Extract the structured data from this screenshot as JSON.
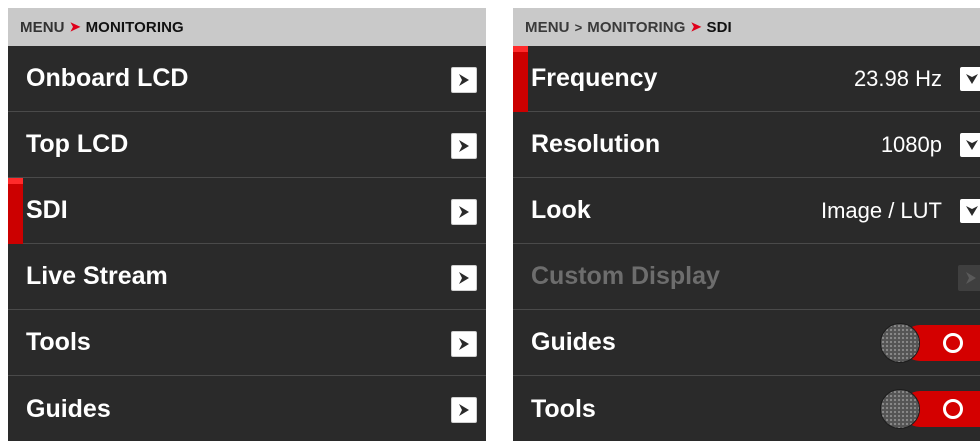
{
  "left": {
    "breadcrumb": {
      "root": "MENU",
      "sep": "➤",
      "current": "MONITORING"
    },
    "items": [
      {
        "label": "Onboard LCD",
        "selected": false
      },
      {
        "label": "Top LCD",
        "selected": false
      },
      {
        "label": "SDI",
        "selected": true
      },
      {
        "label": "Live Stream",
        "selected": false
      },
      {
        "label": "Tools",
        "selected": false
      },
      {
        "label": "Guides",
        "selected": false
      }
    ]
  },
  "right": {
    "breadcrumb": {
      "root": "MENU",
      "sep1": ">",
      "middle": "MONITORING",
      "sep2": "➤",
      "current": "SDI"
    },
    "frequency": {
      "label": "Frequency",
      "value": "23.98 Hz"
    },
    "resolution": {
      "label": "Resolution",
      "value": "1080p"
    },
    "look": {
      "label": "Look",
      "value": "Image / LUT"
    },
    "custom_display": {
      "label": "Custom Display",
      "enabled": false
    },
    "guides": {
      "label": "Guides",
      "toggle": "on"
    },
    "tools": {
      "label": "Tools",
      "toggle": "on"
    }
  },
  "colors": {
    "accent": "#cc0000",
    "panel": "#2a2a2a",
    "header": "#c9c9c9",
    "toggle_on": "#d40000"
  },
  "icons": {
    "arrow": "chevron-right-icon",
    "dropdown": "chevron-down-icon",
    "toggle_knob": "toggle-knob-icon"
  }
}
